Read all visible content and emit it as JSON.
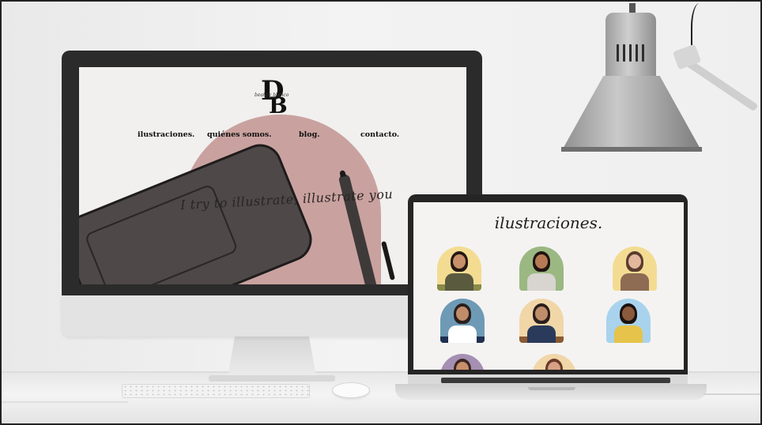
{
  "website": {
    "logo": {
      "letter_top": "D",
      "letter_bottom": "B",
      "script": "beatriz blanco"
    },
    "nav": [
      {
        "label": "ilustraciones."
      },
      {
        "label": "quiénes somos."
      },
      {
        "label": "blog."
      },
      {
        "label": "contacto."
      }
    ],
    "tagline": "I try to illustrate, illustrate you"
  },
  "gallery": {
    "title": "ilustraciones.",
    "cards": [
      {
        "bg": "#f3dc92",
        "skin": "#c8906a",
        "shirt": "#5a5a3f",
        "hair": "#241814",
        "extra": "#8a8a49"
      },
      {
        "bg": "#9bb882",
        "skin": "#b67a56",
        "shirt": "#d8d4cf",
        "hair": "#1f1410",
        "extra": "#9bb882"
      },
      {
        "bg": "#f3dc92",
        "skin": "#e2b79d",
        "shirt": "#8e6b53",
        "hair": "#5a3b2f",
        "extra": "#f3dc92"
      },
      {
        "bg": "#6e9ab5",
        "skin": "#c08d6b",
        "shirt": "#ffffff",
        "hair": "#2a1f1c",
        "extra": "#1f2f52"
      },
      {
        "bg": "#f1d6a8",
        "skin": "#c08d6b",
        "shirt": "#2a3a5a",
        "hair": "#2a1f1c",
        "extra": "#8a5a32"
      },
      {
        "bg": "#a9d3ec",
        "skin": "#8b5a3c",
        "shirt": "#e6c34a",
        "hair": "#1a1210",
        "extra": "#a9d3ec"
      },
      {
        "bg": "#a58fb2",
        "skin": "#c8906a",
        "shirt": "#6a4a5a",
        "hair": "#3a2620",
        "extra": "#a58fb2"
      },
      {
        "bg": "#f1d6a8",
        "skin": "#d7a284",
        "shirt": "#c09880",
        "hair": "#6a3a2a",
        "extra": "#f1d6a8"
      }
    ]
  },
  "colors": {
    "accent_pink": "#c9a29f",
    "tablet": "#4e4848",
    "bezel": "#2c2b2b"
  }
}
